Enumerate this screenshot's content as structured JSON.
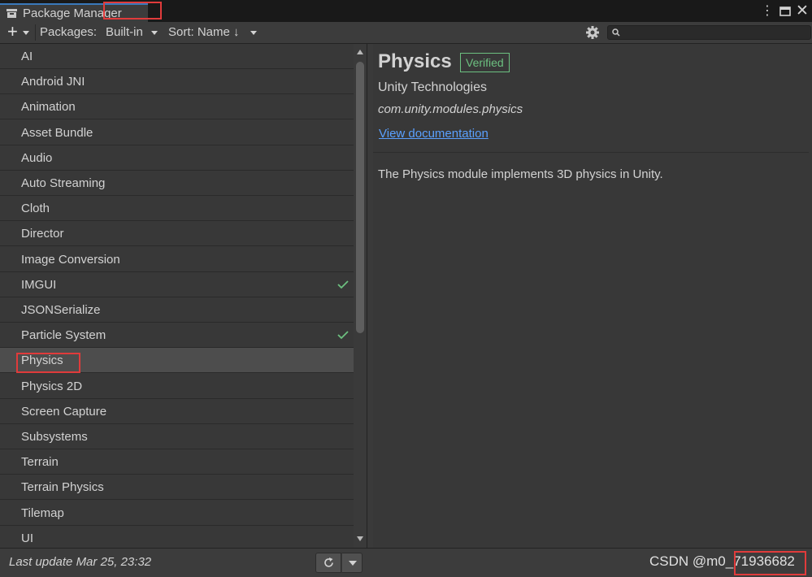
{
  "window": {
    "tab_title": "Package Manager",
    "more_icon": "kebab-menu-icon",
    "maximize_icon": "maximize-icon",
    "close_icon": "close-icon"
  },
  "toolbar": {
    "add_icon": "plus-icon",
    "packages_label": "Packages:",
    "packages_value": "Built-in",
    "sort_label": "Sort: Name ↓",
    "settings_icon": "gear-icon",
    "search_placeholder": "",
    "search_value": ""
  },
  "packages": [
    {
      "name": "AI",
      "installed": false
    },
    {
      "name": "Android JNI",
      "installed": false
    },
    {
      "name": "Animation",
      "installed": false
    },
    {
      "name": "Asset Bundle",
      "installed": false
    },
    {
      "name": "Audio",
      "installed": false
    },
    {
      "name": "Auto Streaming",
      "installed": false
    },
    {
      "name": "Cloth",
      "installed": false
    },
    {
      "name": "Director",
      "installed": false
    },
    {
      "name": "Image Conversion",
      "installed": false
    },
    {
      "name": "IMGUI",
      "installed": true
    },
    {
      "name": "JSONSerialize",
      "installed": false
    },
    {
      "name": "Particle System",
      "installed": true
    },
    {
      "name": "Physics",
      "installed": false,
      "selected": true
    },
    {
      "name": "Physics 2D",
      "installed": false
    },
    {
      "name": "Screen Capture",
      "installed": false
    },
    {
      "name": "Subsystems",
      "installed": false
    },
    {
      "name": "Terrain",
      "installed": false
    },
    {
      "name": "Terrain Physics",
      "installed": false
    },
    {
      "name": "Tilemap",
      "installed": false
    },
    {
      "name": "UI",
      "installed": false
    }
  ],
  "details": {
    "title": "Physics",
    "badge": "Verified",
    "author": "Unity Technologies",
    "package_id": "com.unity.modules.physics",
    "docs_link": "View documentation",
    "description": "The Physics module implements 3D physics in Unity."
  },
  "status": {
    "last_update": "Last update Mar 25, 23:32",
    "refresh_icon": "refresh-icon",
    "watermark": "CSDN @m0_71936682"
  },
  "colors": {
    "accent_blue": "#3a79bb",
    "verified_green": "#6cc080",
    "highlight_red": "#e03b3b",
    "link_blue": "#5aa0ff"
  }
}
